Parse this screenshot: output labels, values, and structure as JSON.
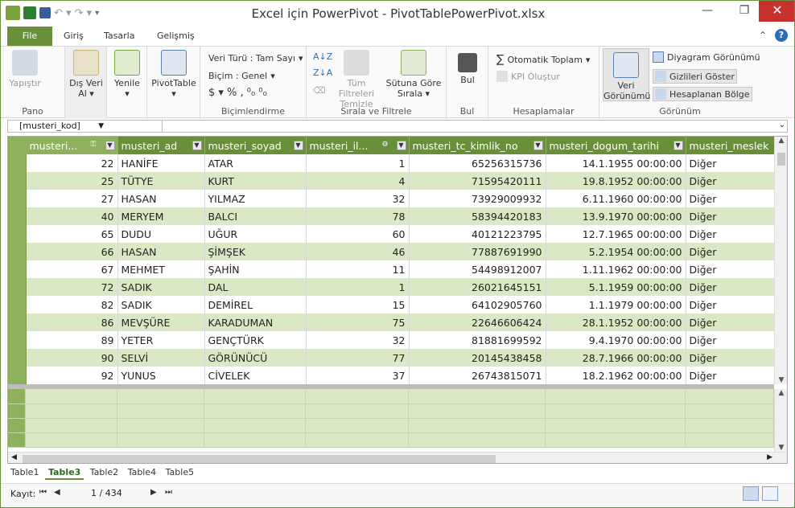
{
  "window": {
    "title": "Excel için PowerPivot - PivotTablePowerPivot.xlsx",
    "minimize": "—",
    "maximize": "❐",
    "close": "✕"
  },
  "tabs": [
    "File",
    "Giriş",
    "Tasarla",
    "Gelişmiş"
  ],
  "ribbon": {
    "pano": {
      "label": "Pano",
      "paste": "Yapıştır"
    },
    "dis_veri": {
      "label": "Dış Veri Al"
    },
    "yenile": {
      "label": "Yenile"
    },
    "pivot": {
      "label": "PivotTable"
    },
    "bicim": {
      "label": "Biçimlendirme",
      "veri_turu": "Veri Türü : Tam Sayı",
      "bicim": "Biçim : Genel",
      "symbols": "$ ▾  %  ,  ⁰₀  ⁰₀"
    },
    "sirala": {
      "label": "Sırala ve Filtrele",
      "temizle": "Tüm Filtreleri Temizle",
      "sutuna": "Sütuna Göre Sırala"
    },
    "bul": {
      "label": "Bul",
      "btn": "Bul"
    },
    "hesap": {
      "label": "Hesaplamalar",
      "oto": "Otomatik Toplam",
      "kpi": "KPI Oluştur"
    },
    "gorunum": {
      "label": "Görünüm",
      "veri": "Veri Görünümü",
      "diyagram": "Diyagram Görünümü",
      "gizli": "Gizlileri Göster",
      "hesaplanan": "Hesaplanan Bölge"
    }
  },
  "formula": {
    "namebox": "[musteri_kod]",
    "expand": "⌄"
  },
  "columns": [
    "musteri...",
    "musteri_ad",
    "musteri_soyad",
    "musteri_il...",
    "musteri_tc_kimlik_no",
    "musteri_dogum_tarihi",
    "musteri_meslek"
  ],
  "rows": [
    [
      "22",
      "HANİFE",
      "ATAR",
      "1",
      "65256315736",
      "14.1.1955 00:00:00",
      "Diğer"
    ],
    [
      "25",
      "TÜTYE",
      "KURT",
      "4",
      "71595420111",
      "19.8.1952 00:00:00",
      "Diğer"
    ],
    [
      "27",
      "HASAN",
      "YILMAZ",
      "32",
      "73929009932",
      "6.11.1960 00:00:00",
      "Diğer"
    ],
    [
      "40",
      "MERYEM",
      "BALCI",
      "78",
      "58394420183",
      "13.9.1970 00:00:00",
      "Diğer"
    ],
    [
      "65",
      "DUDU",
      "UĞUR",
      "60",
      "40121223795",
      "12.7.1965 00:00:00",
      "Diğer"
    ],
    [
      "66",
      "HASAN",
      "ŞİMŞEK",
      "46",
      "77887691990",
      "5.2.1954 00:00:00",
      "Diğer"
    ],
    [
      "67",
      "MEHMET",
      "ŞAHİN",
      "11",
      "54498912007",
      "1.11.1962 00:00:00",
      "Diğer"
    ],
    [
      "72",
      "SADIK",
      "DAL",
      "1",
      "26021645151",
      "5.1.1959 00:00:00",
      "Diğer"
    ],
    [
      "82",
      "SADIK",
      "DEMİREL",
      "15",
      "64102905760",
      "1.1.1979 00:00:00",
      "Diğer"
    ],
    [
      "86",
      "MEVŞÜRE",
      "KARADUMAN",
      "75",
      "22646606424",
      "28.1.1952 00:00:00",
      "Diğer"
    ],
    [
      "89",
      "YETER",
      "GENÇTÜRK",
      "32",
      "81881699592",
      "9.4.1970 00:00:00",
      "Diğer"
    ],
    [
      "90",
      "SELVİ",
      "GÖRÜNÜCÜ",
      "77",
      "20145438458",
      "28.7.1966 00:00:00",
      "Diğer"
    ],
    [
      "92",
      "YUNUS",
      "CİVELEK",
      "37",
      "26743815071",
      "18.2.1962 00:00:00",
      "Diğer"
    ]
  ],
  "sheets": [
    "Table1",
    "Table3",
    "Table2",
    "Table4",
    "Table5"
  ],
  "active_sheet": "Table3",
  "status": {
    "record_label": "Kayıt:",
    "record": "1 / 434"
  },
  "colors": {
    "accent": "#6a8f3a",
    "row_alt": "#dbe8c6",
    "close": "#c7312d"
  }
}
